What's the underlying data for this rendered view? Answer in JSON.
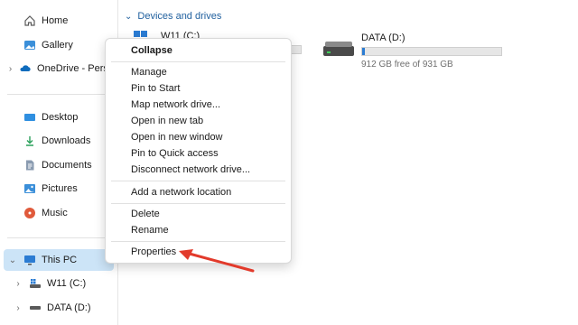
{
  "sidebar": {
    "items": [
      {
        "label": "Home",
        "icon": "home-icon"
      },
      {
        "label": "Gallery",
        "icon": "gallery-icon"
      },
      {
        "label": "OneDrive - Perso",
        "icon": "cloud-icon"
      },
      {
        "label": "Desktop",
        "icon": "desktop-folder-icon"
      },
      {
        "label": "Downloads",
        "icon": "download-icon"
      },
      {
        "label": "Documents",
        "icon": "documents-icon"
      },
      {
        "label": "Pictures",
        "icon": "pictures-icon"
      },
      {
        "label": "Music",
        "icon": "music-icon"
      },
      {
        "label": "This PC",
        "icon": "computer-icon"
      },
      {
        "label": "W11 (C:)",
        "icon": "windows-drive-icon"
      },
      {
        "label": "DATA (D:)",
        "icon": "drive-icon"
      }
    ],
    "selected": "This PC"
  },
  "main": {
    "section_title": "Devices and drives",
    "drives": [
      {
        "name": "W11 (C:)",
        "free": "",
        "used_fraction": null
      },
      {
        "name": "DATA (D:)",
        "free": "912 GB free of 931 GB",
        "used_fraction": 0.02
      }
    ]
  },
  "context_menu": {
    "items": [
      "Collapse",
      "Manage",
      "Pin to Start",
      "Map network drive...",
      "Open in new tab",
      "Open in new window",
      "Pin to Quick access",
      "Disconnect network drive...",
      "Add a network location",
      "Delete",
      "Rename",
      "Properties"
    ]
  },
  "colors": {
    "accent": "#2b7cd3",
    "selection": "#cce4f7",
    "section_header": "#1f5f9e",
    "annotation_arrow": "#e23a2b"
  }
}
